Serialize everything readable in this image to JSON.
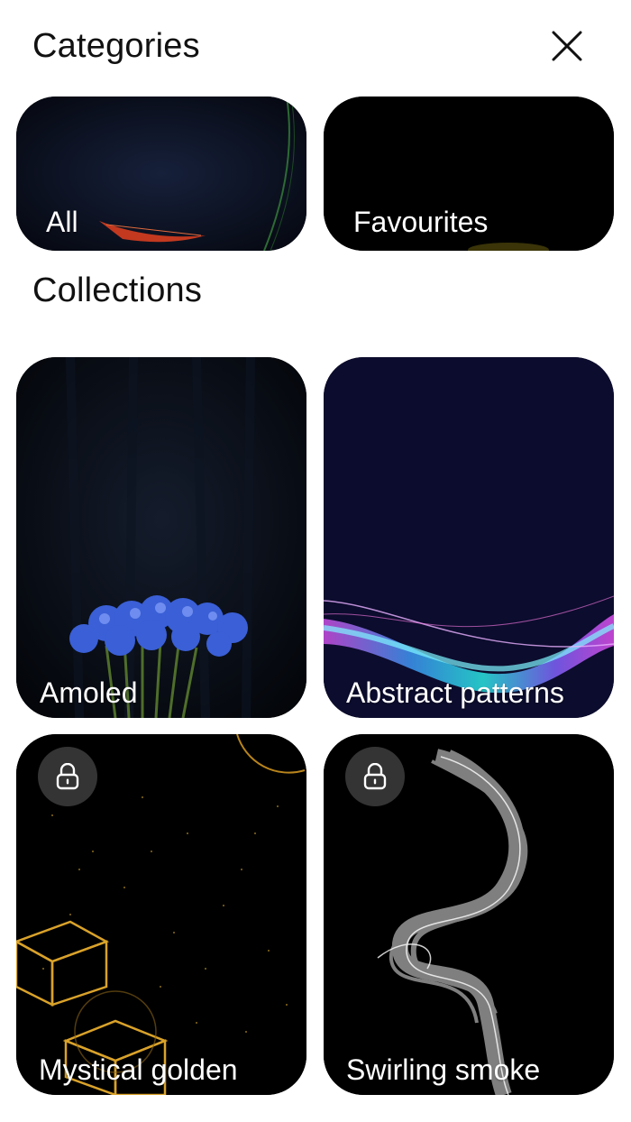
{
  "header": {
    "title": "Categories",
    "close_icon": "close-icon"
  },
  "categories": [
    {
      "label": "All"
    },
    {
      "label": "Favourites"
    }
  ],
  "collections_heading": "Collections",
  "collections": [
    {
      "label": "Amoled",
      "locked": false
    },
    {
      "label": "Abstract patterns",
      "locked": false
    },
    {
      "label": "Mystical golden",
      "locked": true,
      "icon": "lock-icon"
    },
    {
      "label": "Swirling smoke",
      "locked": true,
      "icon": "lock-icon"
    }
  ],
  "colors": {
    "page_background": "#ffffff",
    "tile_background": "#000000",
    "abstract_background": "#0c0c2e",
    "lock_badge": "#464646"
  }
}
